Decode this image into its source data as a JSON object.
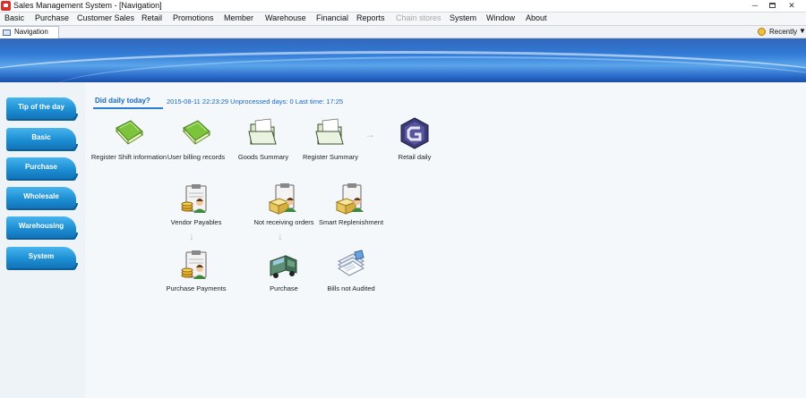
{
  "window": {
    "title": "Sales Management System - [Navigation]",
    "controls": [
      "minimize",
      "maximize",
      "close"
    ]
  },
  "menu": [
    {
      "label": "Basic",
      "enabled": true
    },
    {
      "label": "Purchase",
      "enabled": true
    },
    {
      "label": "Customer Sales",
      "enabled": true
    },
    {
      "label": "Retail",
      "enabled": true
    },
    {
      "label": "Promotions",
      "enabled": true
    },
    {
      "label": "Member",
      "enabled": true
    },
    {
      "label": "Warehouse",
      "enabled": true
    },
    {
      "label": "Financial",
      "enabled": true
    },
    {
      "label": "Reports",
      "enabled": true
    },
    {
      "label": "Chain stores",
      "enabled": false
    },
    {
      "label": "System",
      "enabled": true
    },
    {
      "label": "Window",
      "enabled": true
    },
    {
      "label": "About",
      "enabled": true
    }
  ],
  "tabs": {
    "active": "Navigation",
    "recently_label": "Recently",
    "recently_arrow": "▼"
  },
  "sidebar": [
    {
      "label": "Tip of the day"
    },
    {
      "label": "Basic"
    },
    {
      "label": "Purchase"
    },
    {
      "label": "Wholesale"
    },
    {
      "label": "Warehousing"
    },
    {
      "label": "System"
    }
  ],
  "daily": {
    "title": "Did daily today?",
    "status": "2015-08-11 22:23:29 Unprocessed days: 0 Last time:  17:25"
  },
  "functions": {
    "register_shift": {
      "label": "Register Shift information",
      "icon": "green-book-icon"
    },
    "user_billing": {
      "label": "User billing records",
      "icon": "green-book-icon"
    },
    "goods_summary": {
      "label": "Goods Summary",
      "icon": "open-folder-icon"
    },
    "register_summary": {
      "label": "Register Summary",
      "icon": "open-folder-icon"
    },
    "retail_daily": {
      "label": "Retail daily",
      "icon": "retail-daily-g-icon"
    },
    "vendor_payables": {
      "label": "Vendor Payables",
      "icon": "clipboard-coins-icon"
    },
    "not_receiving": {
      "label": "Not receiving orders",
      "icon": "clipboard-box-icon"
    },
    "smart_replenishment": {
      "label": "Smart Replenishment",
      "icon": "clipboard-box-icon"
    },
    "purchase_payments": {
      "label": "Purchase Payments",
      "icon": "clipboard-coins-icon"
    },
    "purchase": {
      "label": "Purchase",
      "icon": "delivery-truck-icon"
    },
    "bills_not_audited": {
      "label": "Bills not Audited",
      "icon": "document-stack-icon"
    }
  },
  "colors": {
    "accent_blue": "#1768c2",
    "sidebar_button": "#1e8fd4",
    "banner": "#2f7ad6"
  }
}
